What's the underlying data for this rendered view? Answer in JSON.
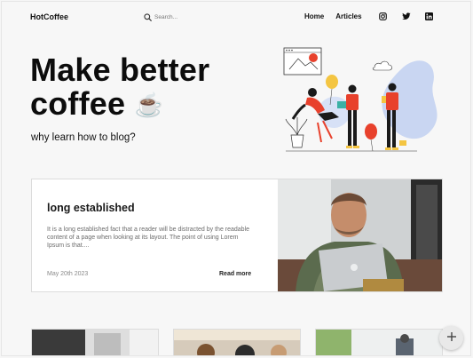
{
  "header": {
    "brand": "HotCoffee",
    "search_placeholder": "Search...",
    "nav": [
      {
        "label": "Home"
      },
      {
        "label": "Articles"
      }
    ],
    "social_icons": [
      "instagram-icon",
      "twitter-icon",
      "linkedin-icon"
    ]
  },
  "hero": {
    "title_line1": "Make better",
    "title_line2": "coffee",
    "title_emoji": "☕",
    "subtitle": "why learn how to blog?"
  },
  "featured": {
    "title": "long established",
    "excerpt": "It is a long established fact that a reader will be distracted by the readable content of a page when looking at its layout. The point of using Lorem Ipsum is that....",
    "date": "May 20th 2023",
    "read_more": "Read more"
  },
  "fab": {
    "icon": "plus-icon"
  },
  "colors": {
    "background": "#f7f7f7",
    "card": "#ffffff",
    "accent_red": "#e8412c",
    "accent_yellow": "#f4c542",
    "illustration_blue": "#c9d6f2"
  }
}
